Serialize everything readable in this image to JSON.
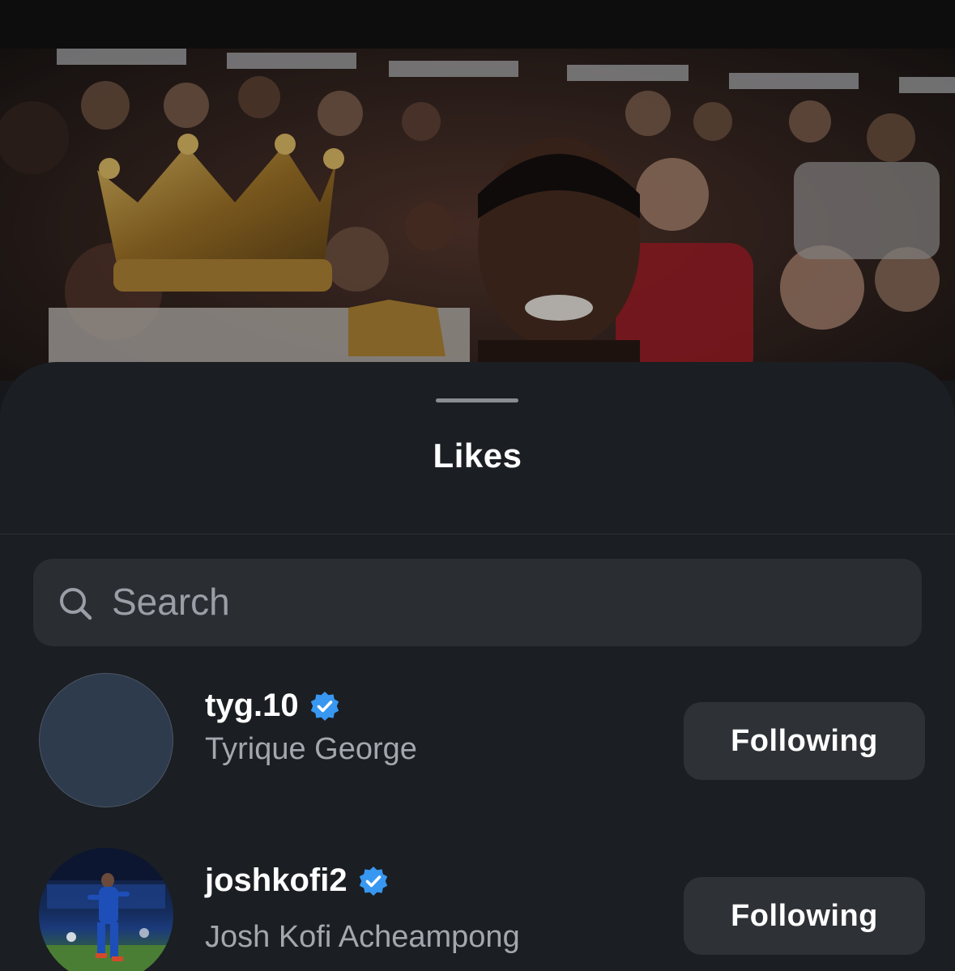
{
  "sheet": {
    "title": "Likes"
  },
  "search": {
    "placeholder": "Search",
    "value": ""
  },
  "users": [
    {
      "username": "tyg.10",
      "full_name": "Tyrique George",
      "verified": true,
      "button_label": "Following"
    },
    {
      "username": "joshkofi2",
      "full_name": "Josh Kofi Acheampong",
      "verified": true,
      "button_label": "Following"
    }
  ],
  "colors": {
    "sheet_bg": "#1b1e22",
    "search_bg": "#2a2d32",
    "button_bg": "#2e3136",
    "verified_blue": "#3897f0",
    "secondary_text": "#a3a7ae"
  },
  "icons": {
    "search": "search-icon",
    "verified": "verified-badge-icon",
    "grabber": "sheet-grabber"
  }
}
